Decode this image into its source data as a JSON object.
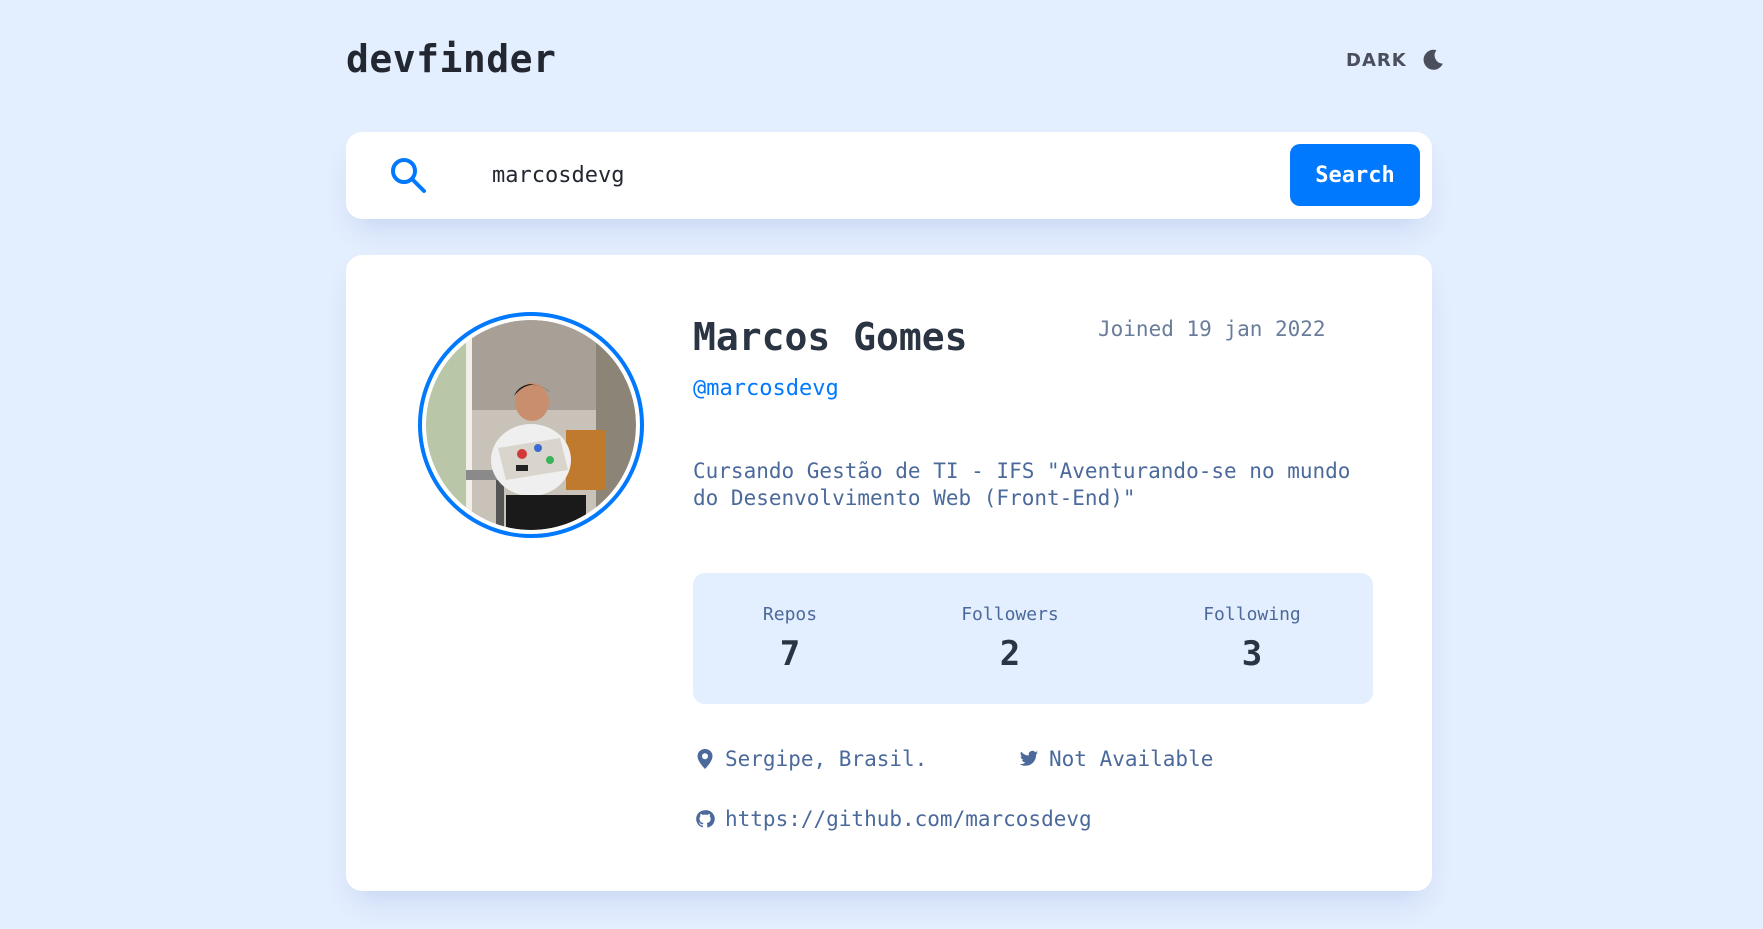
{
  "app": {
    "logo": "devfinder",
    "theme_toggle_label": "DARK"
  },
  "search": {
    "value": "marcosdevg",
    "button_label": "Search"
  },
  "profile": {
    "name": "Marcos Gomes",
    "joined": "Joined 19 jan 2022",
    "login": "@marcosdevg",
    "bio": "Cursando Gestão de TI - IFS \"Aventurando-se no mundo do Desenvolvimento Web (Front-End)\"",
    "stats": {
      "repos_label": "Repos",
      "repos_value": "7",
      "followers_label": "Followers",
      "followers_value": "2",
      "following_label": "Following",
      "following_value": "3"
    },
    "location": "Sergipe, Brasil.",
    "twitter": "Not Available",
    "blog": "https://github.com/marcosdevg"
  },
  "colors": {
    "background": "#e3eefe",
    "card": "#ffffff",
    "accent": "#0079ff",
    "text_dark": "#2b3442",
    "text_muted": "#4b6a9b"
  },
  "icons": {
    "theme": "moon-icon",
    "search": "search-icon",
    "location": "location-pin-icon",
    "twitter": "twitter-icon",
    "blog": "github-icon"
  }
}
